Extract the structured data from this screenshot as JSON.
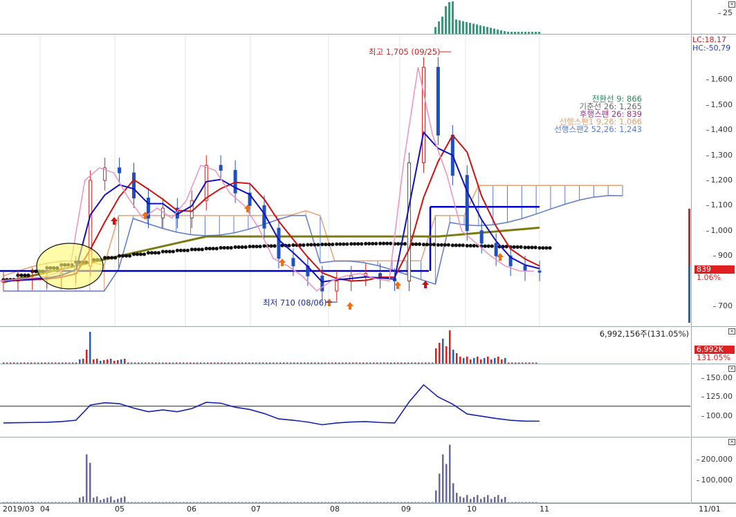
{
  "header": {
    "axis_value": "25"
  },
  "price": {
    "lc_label": "LC:18,17",
    "hc_label": "HC:-50,79",
    "ticks": [
      "1,600",
      "1,500",
      "1,400",
      "1,300",
      "1,200",
      "1,100",
      "1,000",
      "900",
      "700"
    ],
    "current_price": "839",
    "current_pct": "1.06%",
    "high_annotation": "최고 1,705 (09/25)",
    "low_annotation": "최저 710 (08/06)",
    "legend": [
      {
        "text": "전환선 9: 866",
        "color": "#2a8a5a"
      },
      {
        "text": "기준선 26: 1,265",
        "color": "#666666"
      },
      {
        "text": "후행스팬 26: 839",
        "color": "#a0308a"
      },
      {
        "text": "선행스팬1 9,26: 1,066",
        "color": "#e8a070"
      },
      {
        "text": "선행스팬2 52,26: 1,243",
        "color": "#5a7ad0"
      }
    ]
  },
  "volume": {
    "label": "6,992,156주(131.05%)",
    "badge": "6,992K",
    "badge_pct": "131.05%"
  },
  "indicator1": {
    "ticks": [
      "150.00",
      "125.00",
      "100.00"
    ]
  },
  "indicator2": {
    "ticks": [
      "200,000",
      "100,000"
    ]
  },
  "xaxis": [
    "2019/03",
    "04",
    "05",
    "06",
    "07",
    "08",
    "09",
    "10",
    "11",
    "11/01"
  ],
  "colors": {
    "up": "#d42020",
    "down": "#2050c0",
    "ma_black": "#111111",
    "ma_olive": "#7a7a10",
    "line_blue": "#0000cc",
    "cloud_orange": "#e8a070",
    "cloud_blue": "#5a7ad0"
  },
  "chart_data": {
    "type": "line",
    "title": "",
    "price_range": [
      620,
      1780
    ],
    "price_ticks": [
      1600,
      1500,
      1400,
      1300,
      1200,
      1100,
      1000,
      900,
      700
    ],
    "high": {
      "value": 1705,
      "date": "09/25"
    },
    "low": {
      "value": 710,
      "date": "08/06"
    },
    "x": [
      "2019/03",
      "04",
      "05",
      "06",
      "07",
      "08",
      "09",
      "10",
      "11"
    ],
    "close_series": [
      800,
      805,
      810,
      815,
      830,
      860,
      1200,
      1250,
      1230,
      1130,
      1050,
      1090,
      1050,
      1120,
      1260,
      1240,
      1150,
      1100,
      1010,
      890,
      860,
      820,
      760,
      800,
      820,
      830,
      810,
      800,
      1270,
      1650,
      1380,
      1220,
      1000,
      950,
      900,
      860,
      840,
      839
    ],
    "indicator1_ticks": [
      150,
      125,
      100
    ],
    "indicator2_ticks": [
      200000,
      100000
    ]
  }
}
